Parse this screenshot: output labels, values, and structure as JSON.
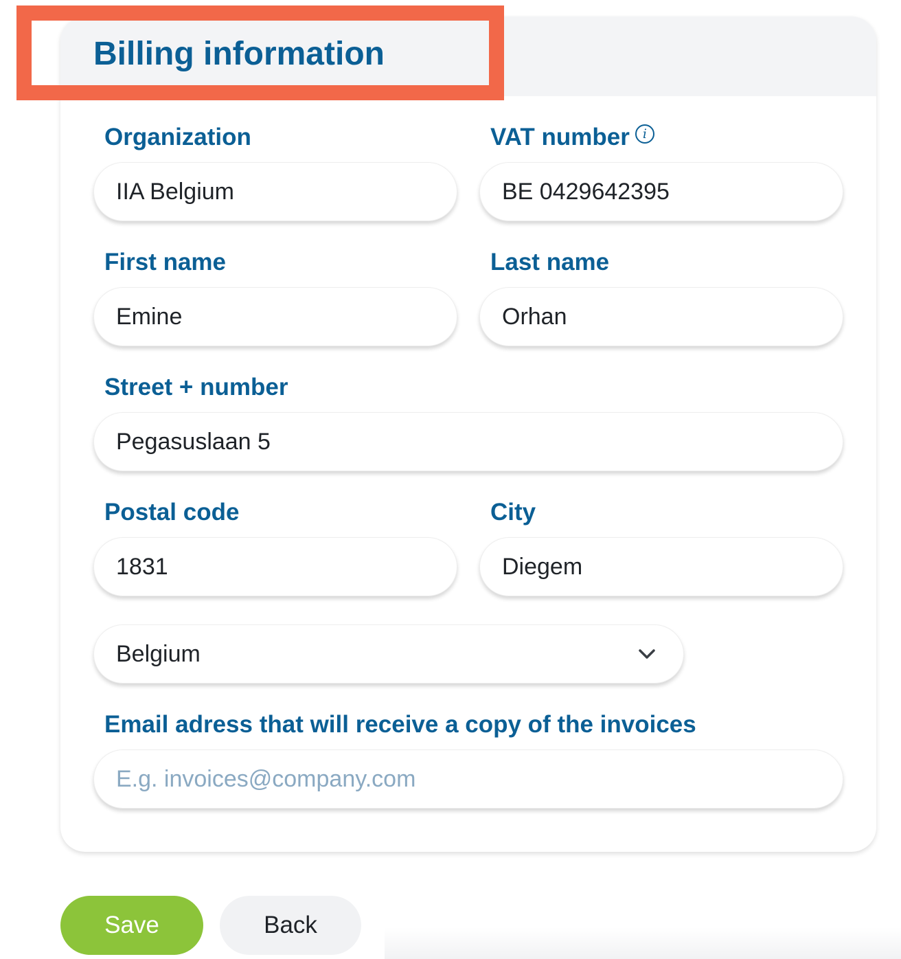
{
  "header": {
    "title": "Billing information"
  },
  "form": {
    "organization": {
      "label": "Organization",
      "value": "IIA Belgium"
    },
    "vat_number": {
      "label": "VAT number",
      "value": "BE 0429642395",
      "info_icon": "info-icon"
    },
    "first_name": {
      "label": "First name",
      "value": "Emine"
    },
    "last_name": {
      "label": "Last name",
      "value": "Orhan"
    },
    "street": {
      "label": "Street + number",
      "value": "Pegasuslaan 5"
    },
    "postal_code": {
      "label": "Postal code",
      "value": "1831"
    },
    "city": {
      "label": "City",
      "value": "Diegem"
    },
    "country": {
      "selected": "Belgium",
      "icon": "chevron-down-icon"
    },
    "invoice_email": {
      "label": "Email adress that will receive a copy of the invoices",
      "value": "",
      "placeholder": "E.g. invoices@company.com"
    }
  },
  "actions": {
    "save_label": "Save",
    "back_label": "Back"
  },
  "colors": {
    "accent": "#0b5f95",
    "save_button": "#8cc43a",
    "highlight": "#f26849",
    "header_background": "#f3f4f6"
  }
}
